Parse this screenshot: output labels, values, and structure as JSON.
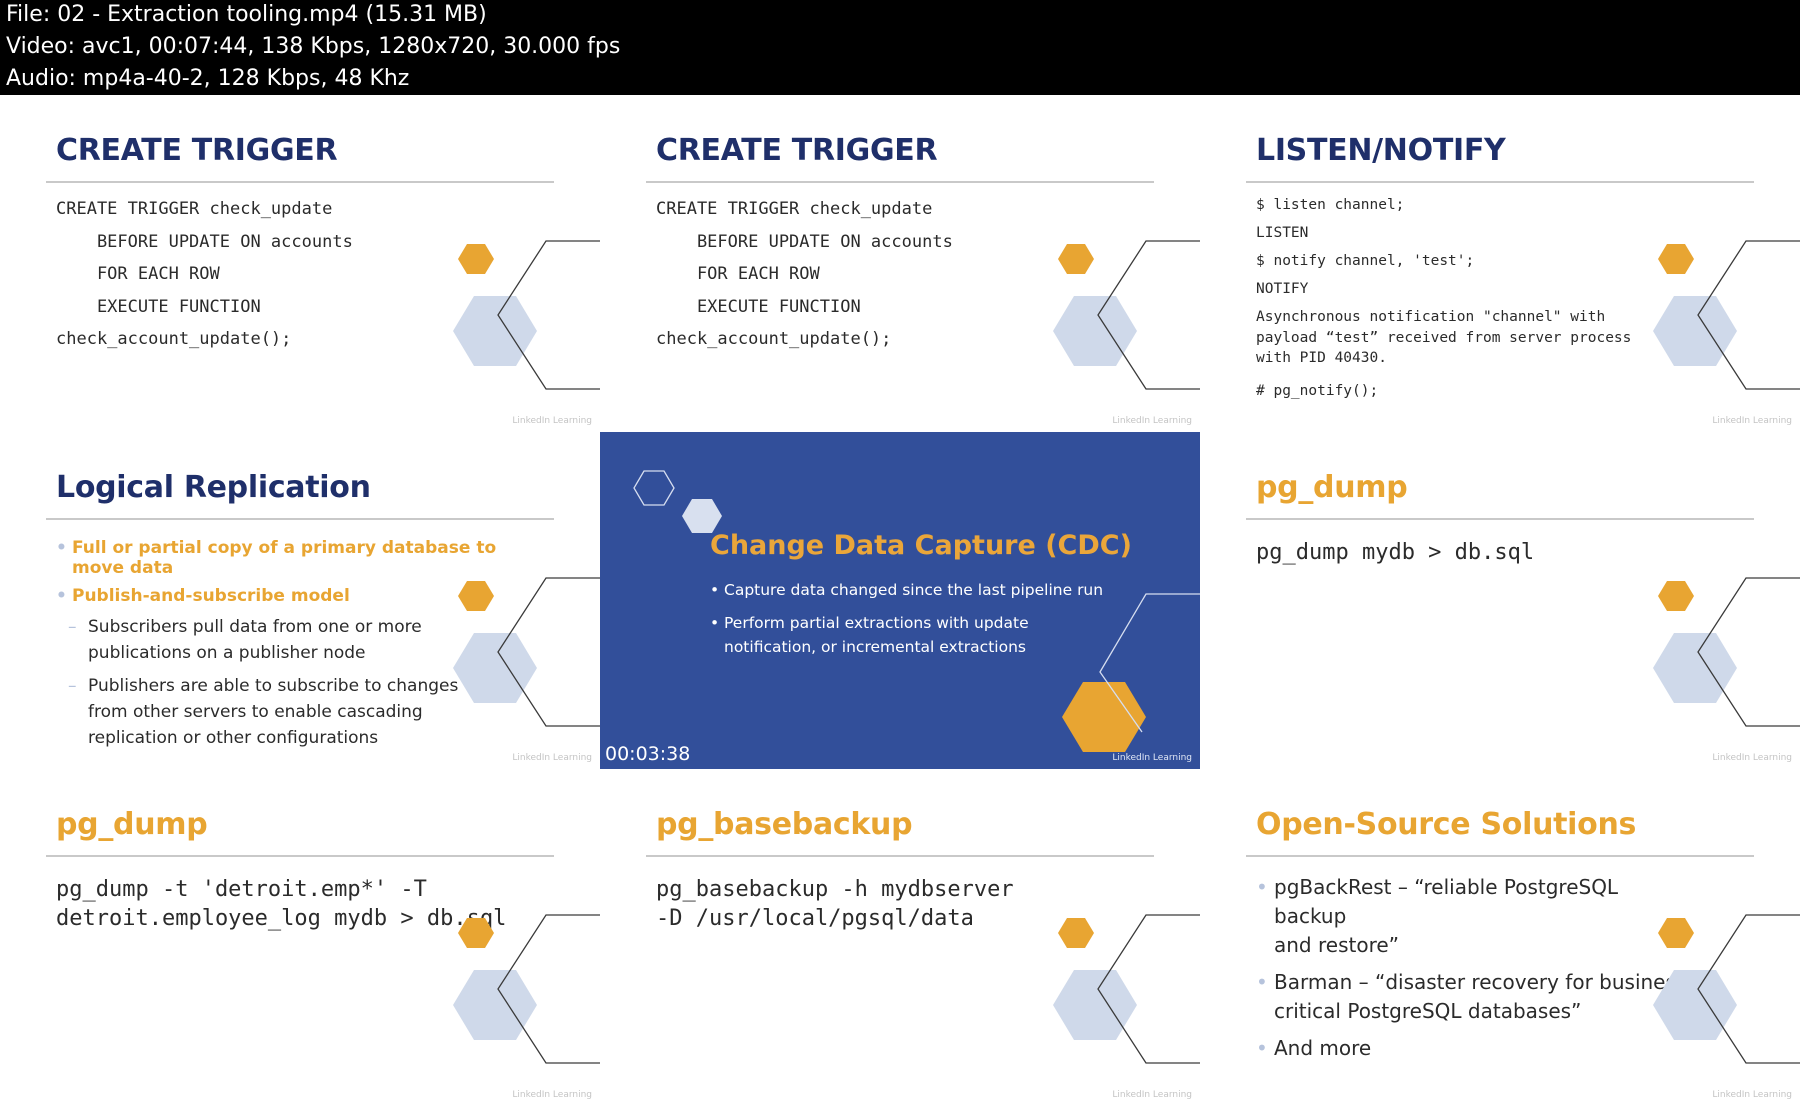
{
  "header": {
    "file_line": "File: 02 - Extraction tooling.mp4 (15.31 MB)",
    "video_line": "Video: avc1, 00:07:44, 138 Kbps, 1280x720, 30.000 fps",
    "audio_line": "Audio: mp4a-40-2, 128 Kbps, 48 Khz"
  },
  "brand": {
    "watermark": "LinkedIn Learning"
  },
  "colors": {
    "navy": "#1f2f6a",
    "orange": "#e8a532",
    "slide_blue": "#324f9a",
    "hex_light": "#cfd9ea"
  },
  "tiles": {
    "t1": {
      "title": "CREATE TRIGGER",
      "lines": [
        "CREATE TRIGGER check_update",
        "    BEFORE UPDATE ON accounts",
        "    FOR EACH ROW",
        "    EXECUTE FUNCTION",
        "check_account_update();"
      ]
    },
    "t2": {
      "title": "CREATE TRIGGER",
      "lines": [
        "CREATE TRIGGER check_update",
        "    BEFORE UPDATE ON accounts",
        "    FOR EACH ROW",
        "    EXECUTE FUNCTION",
        "check_account_update();"
      ]
    },
    "t3": {
      "title": "LISTEN/NOTIFY",
      "lines": [
        "$ listen channel;",
        "LISTEN",
        "$ notify channel, 'test';",
        "NOTIFY"
      ],
      "message": [
        "Asynchronous notification \"channel\" with",
        "payload “test” received from server process",
        "with PID 40430."
      ],
      "last": "# pg_notify();"
    },
    "t4": {
      "title": "Logical Replication",
      "bullets": [
        "Full or partial copy of a primary database to move data",
        "Publish-and-subscribe model"
      ],
      "subbullets": [
        [
          "Subscribers pull data from one or more",
          "publications on a publisher node"
        ],
        [
          "Publishers are able to subscribe to changes",
          "from other servers to enable cascading",
          "replication or other configurations"
        ]
      ]
    },
    "t5": {
      "title": "Change Data Capture (CDC)",
      "bullets": [
        [
          "Capture data changed since the last pipeline run"
        ],
        [
          "Perform partial extractions with update",
          "notification, or incremental extractions"
        ]
      ],
      "timestamp": "00:03:38"
    },
    "t6": {
      "title": "pg_dump",
      "lines": [
        "pg_dump mydb > db.sql"
      ]
    },
    "t7": {
      "title": "pg_dump",
      "lines": [
        "pg_dump -t 'detroit.emp*' -T",
        "detroit.employee_log mydb > db.sql"
      ]
    },
    "t8": {
      "title": "pg_basebackup",
      "lines": [
        "pg_basebackup -h mydbserver",
        "-D /usr/local/pgsql/data"
      ]
    },
    "t9": {
      "title": "Open-Source Solutions",
      "bullets": [
        [
          "pgBackRest – “reliable PostgreSQL backup",
          "and restore”"
        ],
        [
          "Barman – “disaster recovery for business",
          "critical PostgreSQL databases”"
        ],
        [
          "And more"
        ]
      ]
    }
  }
}
